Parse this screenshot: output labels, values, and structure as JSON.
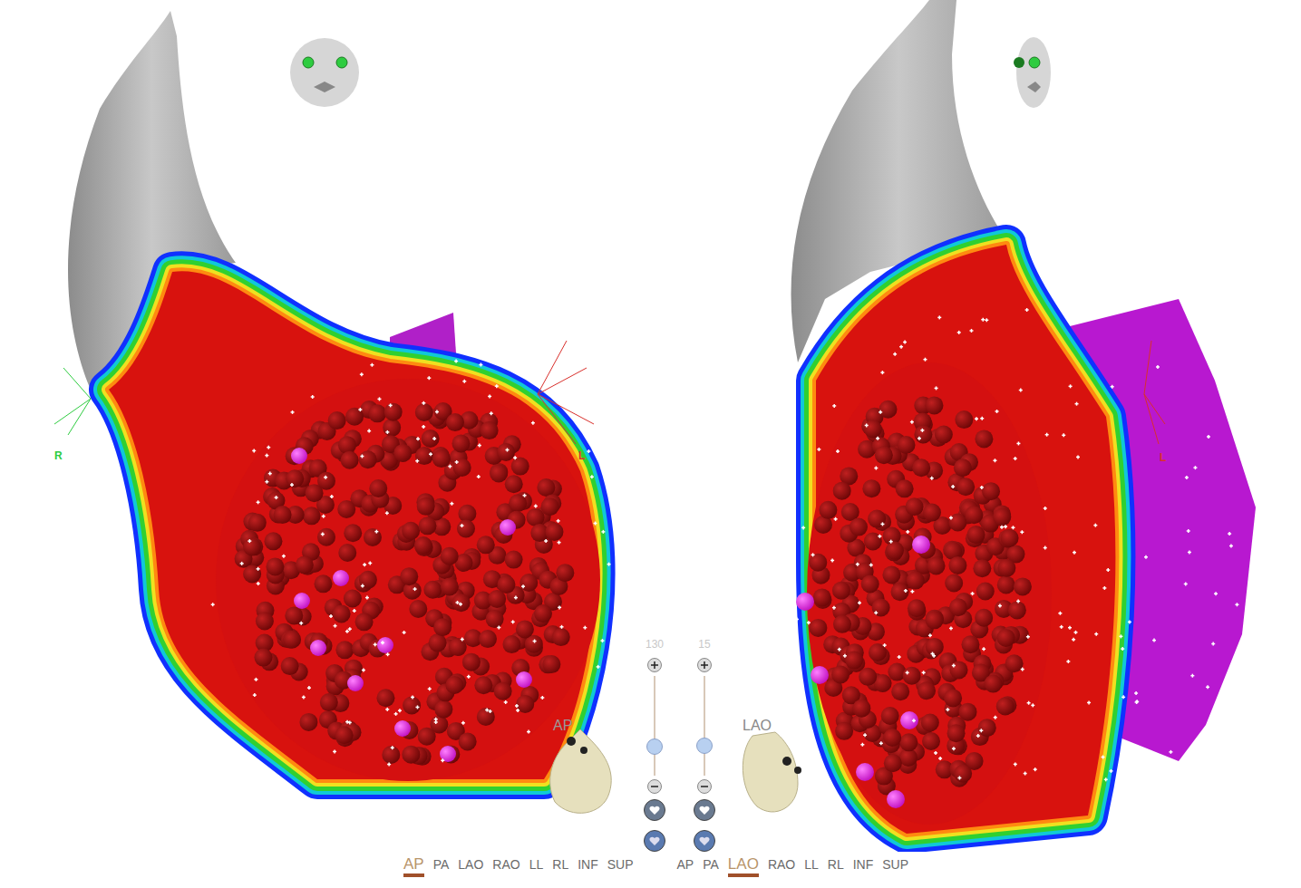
{
  "views": [
    {
      "label": "AP",
      "axes": [
        {
          "label": "R",
          "color": "#2ecc40"
        },
        {
          "label": "L",
          "color": "#d9302c"
        }
      ]
    },
    {
      "label": "LAO",
      "axes": [
        {
          "label": "L",
          "color": "#d9302c"
        }
      ]
    }
  ],
  "sliders": [
    {
      "label": "130",
      "level": 0.29
    },
    {
      "label": "15",
      "level": 0.3
    }
  ],
  "view_bars": [
    {
      "items": [
        {
          "label": "AP",
          "selected": true
        },
        {
          "label": "PA",
          "selected": false
        },
        {
          "label": "LAO",
          "selected": false
        },
        {
          "label": "RAO",
          "selected": false
        },
        {
          "label": "LL",
          "selected": false
        },
        {
          "label": "RL",
          "selected": false
        },
        {
          "label": "INF",
          "selected": false
        },
        {
          "label": "SUP",
          "selected": false
        }
      ]
    },
    {
      "items": [
        {
          "label": "AP",
          "selected": false
        },
        {
          "label": "PA",
          "selected": false
        },
        {
          "label": "LAO",
          "selected": true
        },
        {
          "label": "RAO",
          "selected": false
        },
        {
          "label": "LL",
          "selected": false
        },
        {
          "label": "RL",
          "selected": false
        },
        {
          "label": "INF",
          "selected": false
        },
        {
          "label": "SUP",
          "selected": false
        }
      ]
    }
  ]
}
